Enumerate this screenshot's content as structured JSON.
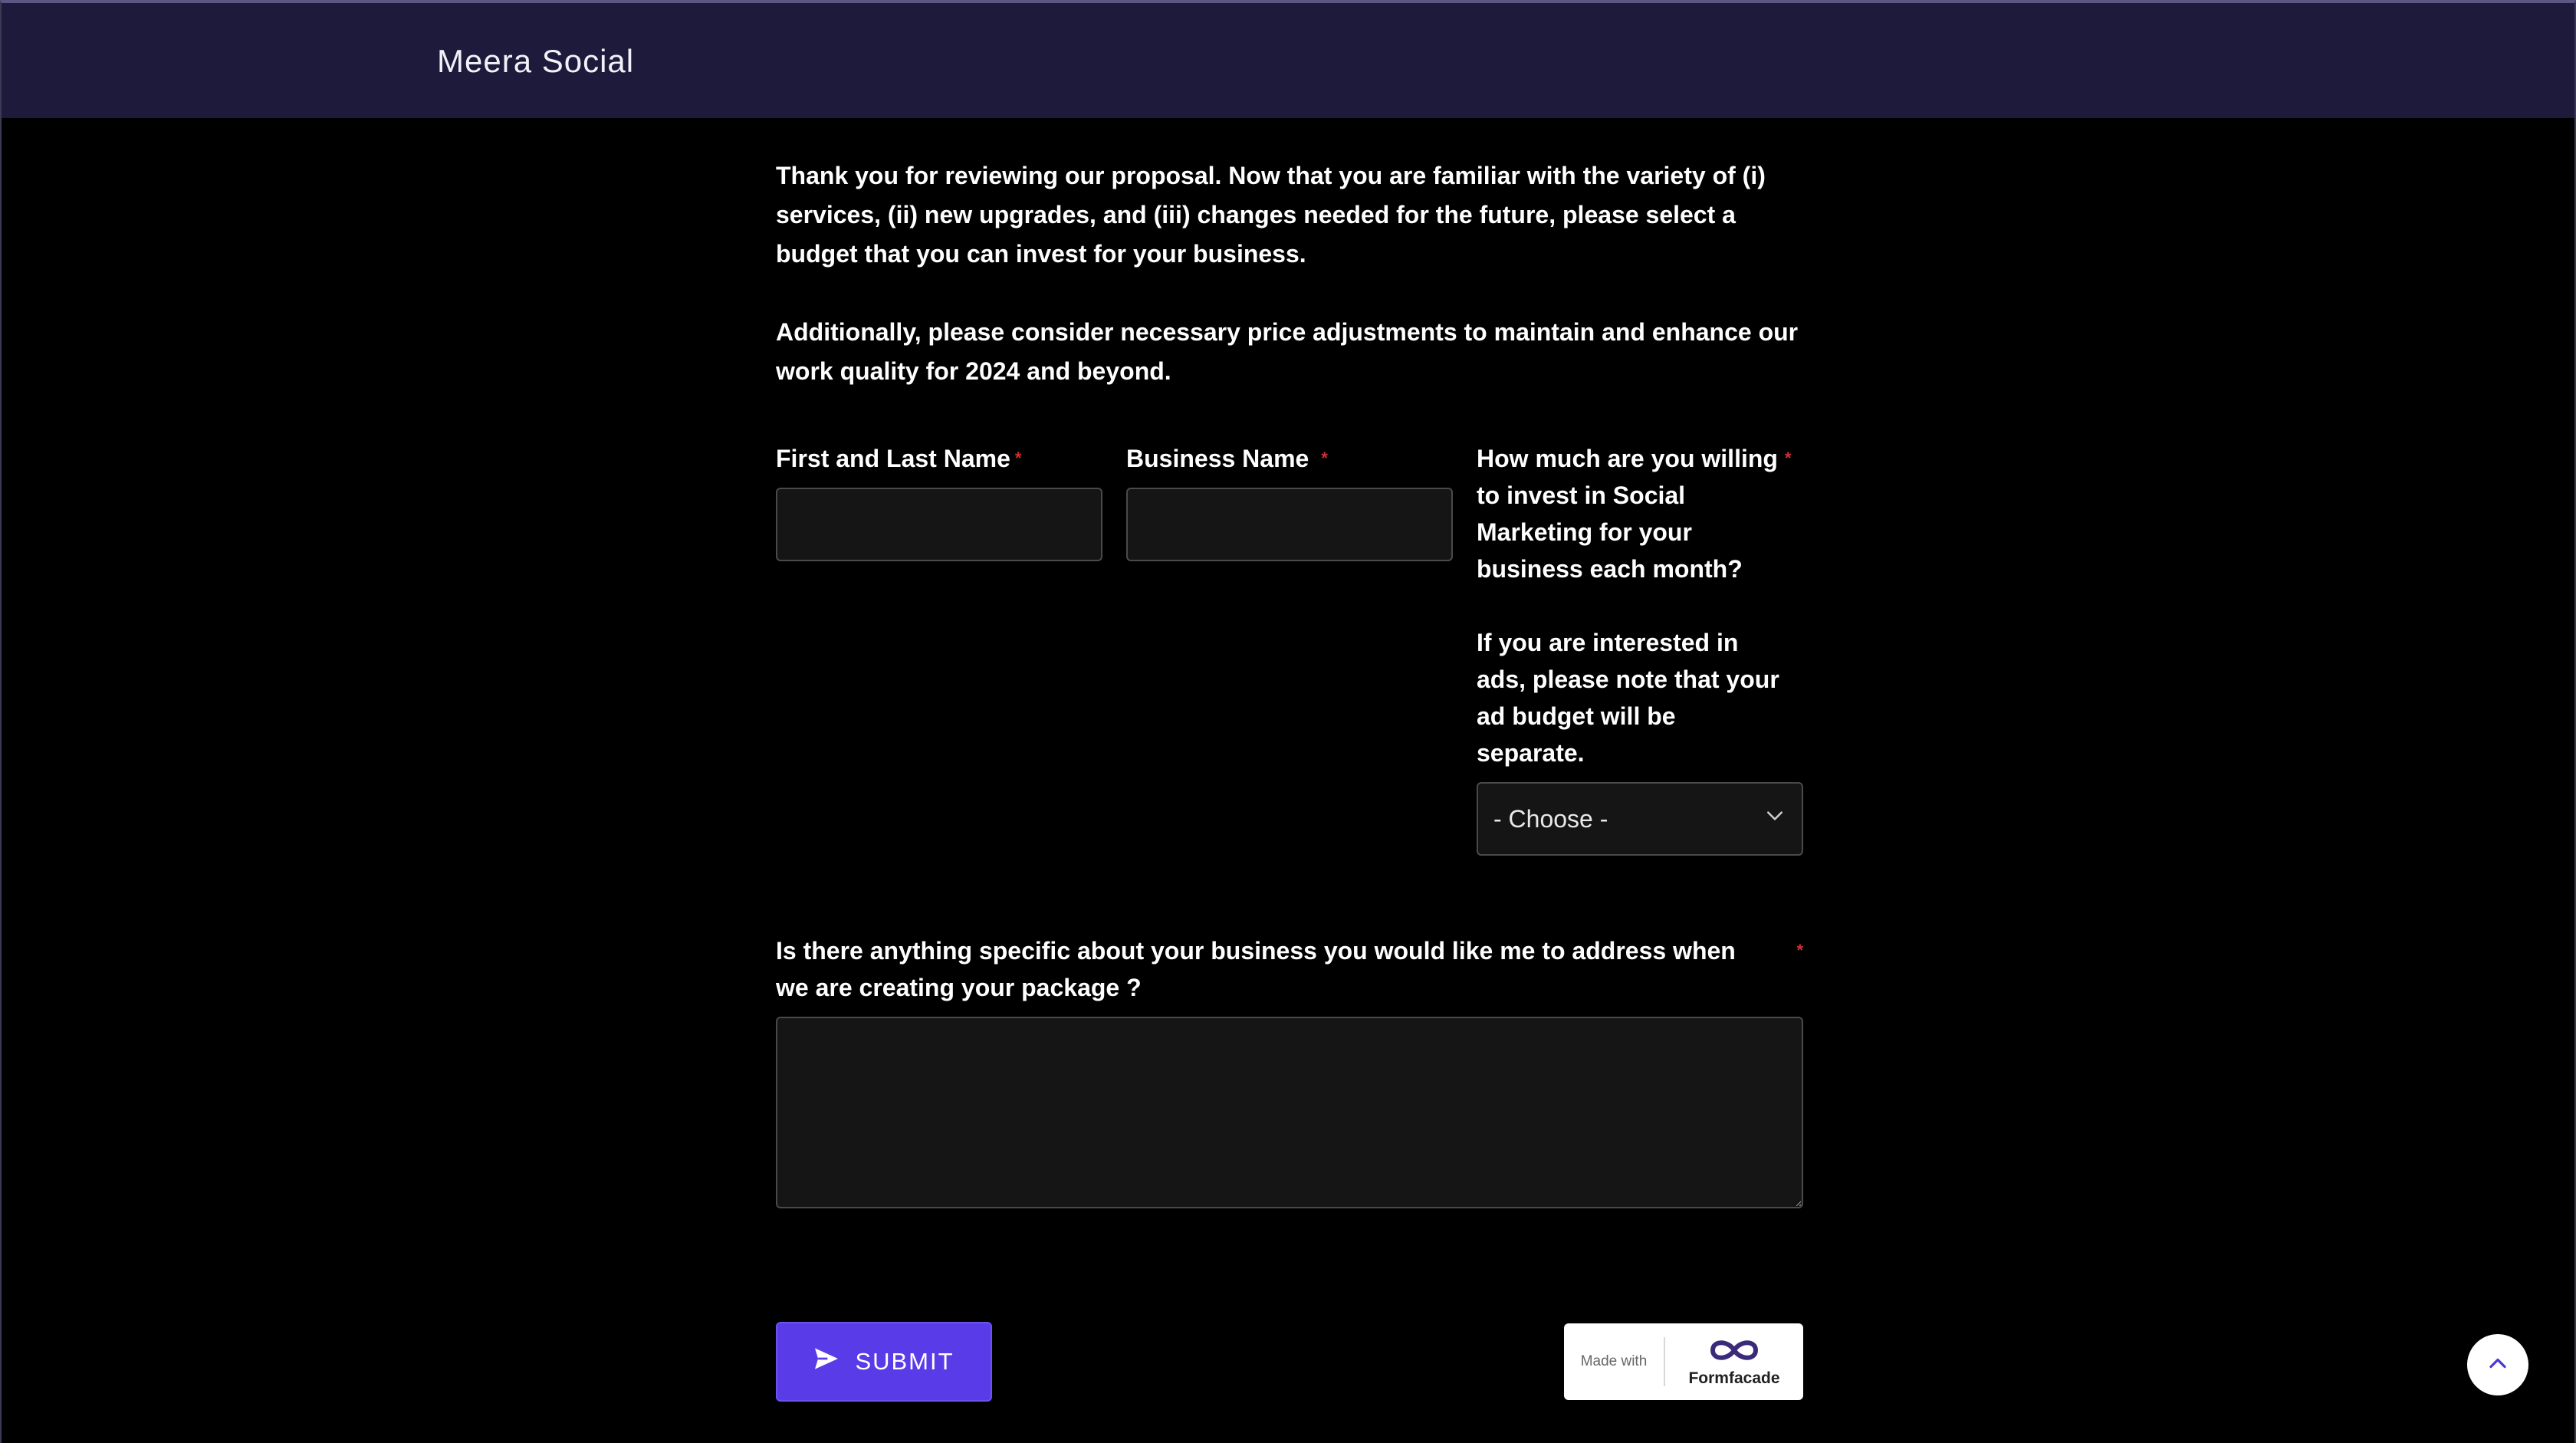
{
  "header": {
    "brand": "Meera Social"
  },
  "intro": {
    "paragraph1": "Thank you for reviewing our proposal. Now that you are familiar with the variety of (i) services, (ii) new upgrades, and (iii) changes needed for the future, please select a budget that you can invest for your business.",
    "paragraph2": "Additionally, please consider necessary price adjustments to maintain and enhance our work quality for 2024 and beyond."
  },
  "form": {
    "name_label": "First and Last Name",
    "business_label": "Business Name",
    "required_mark": "*",
    "budget_label": "How much are you willing to invest in Social Marketing for your business each month?",
    "budget_note": "If you are interested in ads, please note that your ad budget will be separate.",
    "budget_select_value": "- Choose -",
    "specific_label": "Is there anything specific about your business you would like me to address when we are creating your package ?",
    "name_value": "",
    "business_value": "",
    "specific_value": ""
  },
  "actions": {
    "submit_label": "SUBMIT"
  },
  "badge": {
    "made_with": "Made with",
    "brand": "Formfacade"
  },
  "colors": {
    "header_bg": "#1d1a3c",
    "accent": "#5a3be8",
    "required": "#d32f2f",
    "badge_logo": "#3b2a7a"
  },
  "icons": {
    "submit": "send-icon",
    "select": "chevron-down-icon",
    "scroll": "chevron-up-icon",
    "badge": "infinity-logo-icon"
  }
}
